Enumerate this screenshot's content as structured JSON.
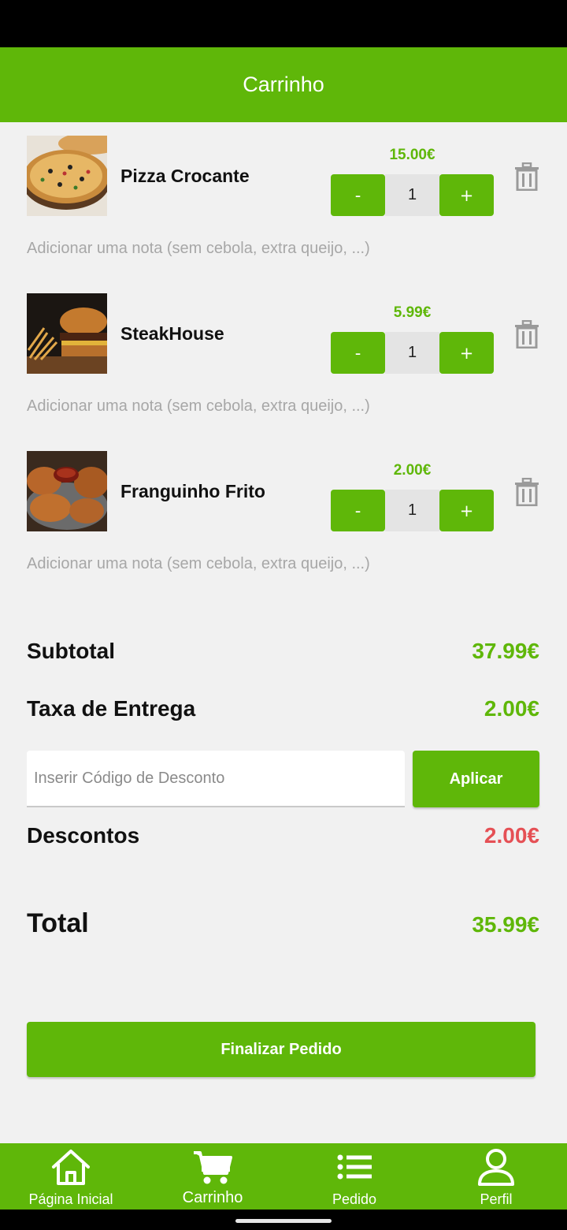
{
  "header": {
    "title": "Carrinho"
  },
  "items": [
    {
      "name": "Pizza Crocante",
      "price": "15.00€",
      "quantity": "1",
      "minus": "-",
      "plus": "+",
      "note_placeholder": "Adicionar uma nota (sem cebola, extra queijo, ...)"
    },
    {
      "name": "SteakHouse",
      "price": "5.99€",
      "quantity": "1",
      "minus": "-",
      "plus": "+",
      "note_placeholder": "Adicionar uma nota (sem cebola, extra queijo, ...)"
    },
    {
      "name": "Franguinho Frito",
      "price": "2.00€",
      "quantity": "1",
      "minus": "-",
      "plus": "+",
      "note_placeholder": "Adicionar uma nota (sem cebola, extra queijo, ...)"
    }
  ],
  "summary": {
    "subtotal_label": "Subtotal",
    "subtotal_value": "37.99€",
    "delivery_label": "Taxa de Entrega",
    "delivery_value": "2.00€",
    "discount_placeholder": "Inserir Código de Desconto",
    "apply_label": "Aplicar",
    "discounts_label": "Descontos",
    "discounts_value": "2.00€",
    "total_label": "Total",
    "total_value": "35.99€"
  },
  "checkout_label": "Finalizar Pedido",
  "nav": {
    "home": "Página Inicial",
    "cart": "Carrinho",
    "orders": "Pedido",
    "profile": "Perfil"
  },
  "colors": {
    "accent": "#5fb709",
    "discount": "#e55055",
    "background": "#f1f1f1"
  },
  "icons": {
    "trash": "trash-icon",
    "home": "home-icon",
    "cart": "cart-icon",
    "orders": "list-icon",
    "profile": "user-icon"
  }
}
